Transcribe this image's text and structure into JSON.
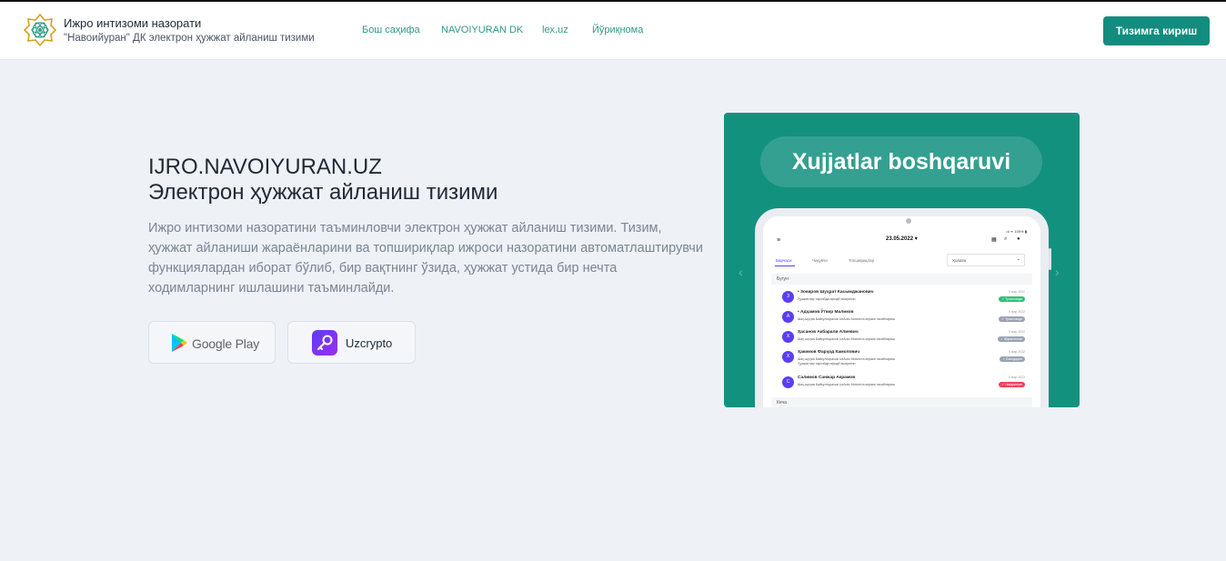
{
  "header": {
    "title": "Ижро интизоми назорати",
    "subtitle": "\"Навоийуран\" ДК электрон ҳужжат айланиш тизими",
    "nav": [
      {
        "label": "Бош саҳифа"
      },
      {
        "label": "NAVOIYURAN DK"
      },
      {
        "label": "lex.uz"
      },
      {
        "label": "Йўриқнома"
      }
    ],
    "login_label": "Тизимга кириш"
  },
  "hero": {
    "title": "IJRO.NAVOIYURAN.UZ",
    "subtitle": "Электрон ҳужжат айланиш тизими",
    "description": "Ижро интизоми назоратини таъминловчи электрон ҳужжат айланиш тизими. Тизим, ҳужжат айланиши жараёнларини ва топшириқлар ижроси назоратини автоматлаштирувчи функциялардан иборат бўлиб, бир вақтнинг ўзида, ҳужжат устида бир нечта ходимларнинг ишлашини таъминлайди.",
    "stores": {
      "google_play": "Google Play",
      "uzcrypto": "Uzcrypto"
    }
  },
  "promo": {
    "pill_text": "Xujjatlar boshqaruvi",
    "status_bar": "•ıl ᯤ 100% ▮",
    "date": "23.05.2022 ▾",
    "tabs": [
      "Барчаси",
      "Чиқувчи",
      "Топшириқлар"
    ],
    "dropdown": "Ҳолати",
    "section_today": "Бугун",
    "section_yesterday": "Кеча",
    "rows": [
      {
        "initial": "З",
        "name": "• Зокиров Шуҳрат Касымджанович",
        "desc": "Ҳужжатлар таргибда ифодб юкиритин",
        "desc2": "",
        "date": "5 мар 2022",
        "badge": "✓ Тугалланди",
        "badge_color": "#2fc07a"
      },
      {
        "initial": "А",
        "name": "• Адҳамов Ўткир Маликов",
        "desc": "Шаҳ-шуҳиа Байкулторахов UzAuto Motors'га керакя тасаблариш",
        "desc2": "",
        "date": "5 мар 2022",
        "badge": "✓ Тугалланди",
        "badge_color": "#9aa2b1"
      },
      {
        "initial": "Х",
        "name": "Ҳасанов Акбарали Алиевич",
        "desc": "Шаҳ-шуҳиа Байкулторахов UzAuto Motors'га керакя тасаблариш",
        "desc2": "",
        "date": "5 мар 2022",
        "badge": "✓ Кўрсатилган",
        "badge_color": "#9aa2b1"
      },
      {
        "initial": "Х",
        "name": "Ҳакимов Фарҳод Камолович",
        "desc": "Шаҳ-шуҳиа Байкулторахов UzAuto Motors'га керакя тасаблариш",
        "desc2": "Ҳужжатлар таргибда ифодб юкиритин",
        "date": "5 мар 2022",
        "badge": "✓ Ёзилдирин",
        "badge_color": "#9aa2b1"
      },
      {
        "initial": "С",
        "name": "Салимов Санжар Акрамов",
        "desc": "Шаҳ-шуҳиа Байкулторахов UzAuto Motors'га керакя тасаблариш",
        "desc2": "",
        "date": "5 мар 2022",
        "badge": "✓ Чиқарилган",
        "badge_color": "#f0415a"
      }
    ]
  },
  "colors": {
    "accent": "#128c7e",
    "promo_bg": "#13917f",
    "nav_link": "#2d9a8a",
    "avatar": "#5b3df5"
  },
  "icons": [
    "logo-icon",
    "google-play-icon",
    "uzcrypto-key-icon",
    "menu-icon",
    "grid-icon",
    "search-icon",
    "user-icon",
    "chevron-left-icon",
    "chevron-right-icon"
  ]
}
